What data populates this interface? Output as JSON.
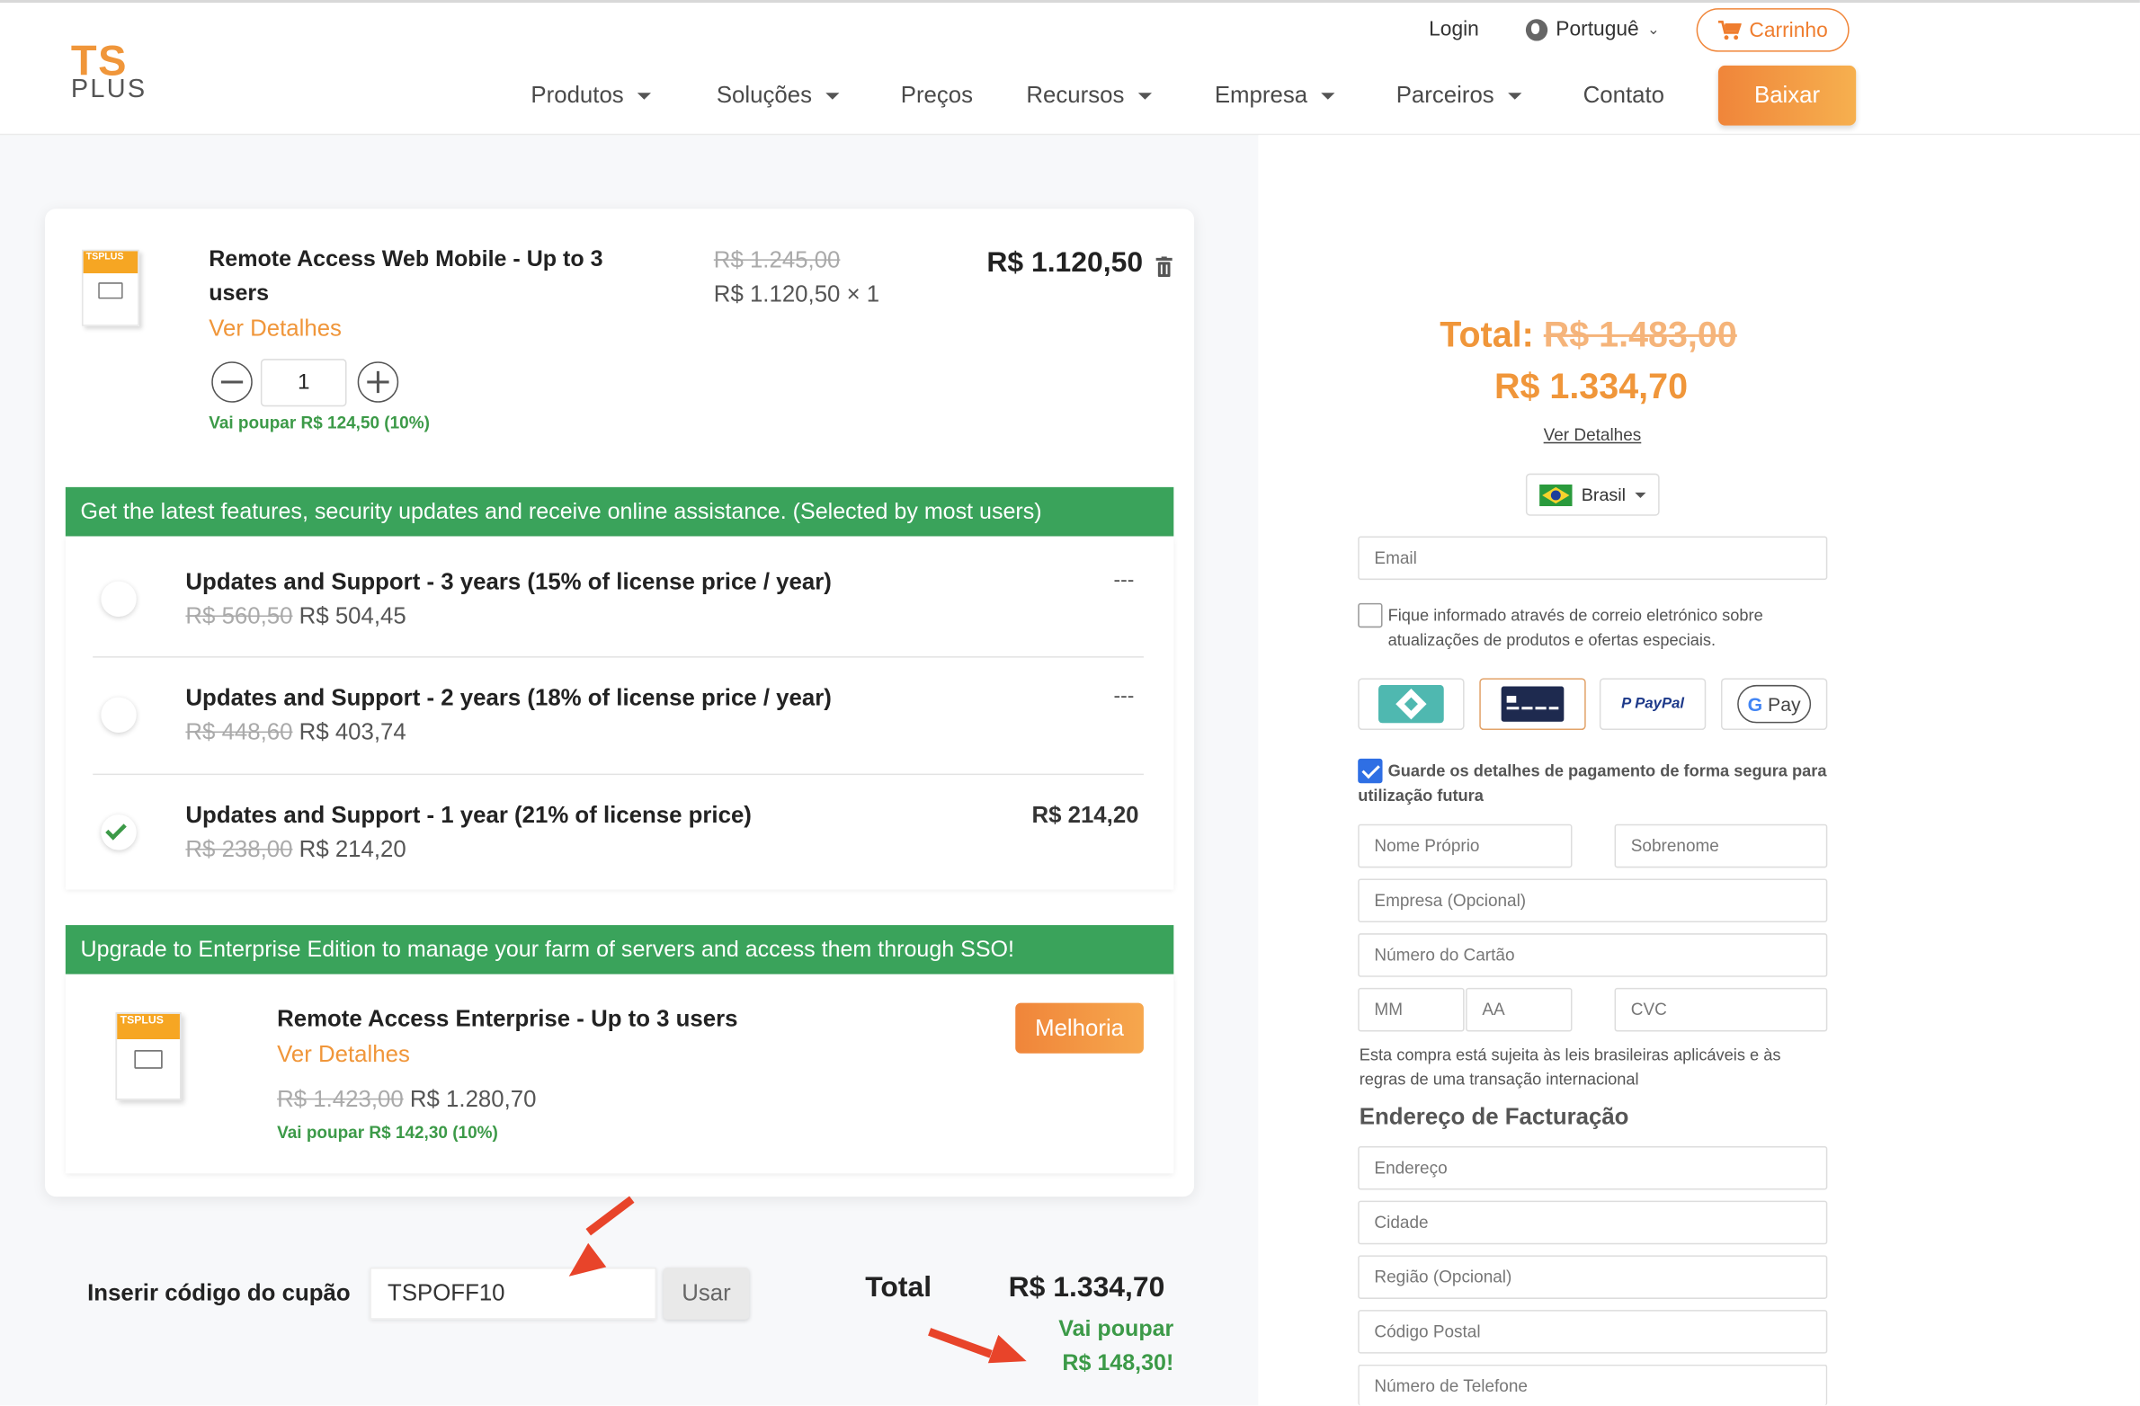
{
  "header": {
    "logo_top": "TS",
    "logo_bottom": "PLUS",
    "login": "Login",
    "language": "Portuguê",
    "cart": "Carrinho",
    "nav": [
      "Produtos",
      "Soluções",
      "Preços",
      "Recursos",
      "Empresa",
      "Parceiros",
      "Contato"
    ],
    "download": "Baixar"
  },
  "cart_item": {
    "title": "Remote Access Web Mobile - Up to 3 users",
    "title_line1": "Remote Access Web Mobile - Up to 3",
    "title_line2": "users",
    "details_link": "Ver Detalhes",
    "old_price": "R$ 1.245,00",
    "unit_price": "R$ 1.120,50 × 1",
    "line_total": "R$ 1.120,50",
    "quantity": "1",
    "savings": "Vai poupar R$ 124,50 (10%)",
    "box_label": "TSPLUS"
  },
  "support": {
    "banner": "Get the latest features, security updates and receive online assistance. (Selected by most users)",
    "options": [
      {
        "title": "Updates and Support - 3 years (15% of license price / year)",
        "old": "R$ 560,50",
        "price": "R$ 504,45",
        "right": "---",
        "selected": false
      },
      {
        "title": "Updates and Support - 2 years (18% of license price / year)",
        "old": "R$ 448,60",
        "price": "R$ 403,74",
        "right": "---",
        "selected": false
      },
      {
        "title": "Updates and Support - 1 year (21% of license price)",
        "old": "R$ 238,00",
        "price": "R$ 214,20",
        "right": "R$ 214,20",
        "selected": true
      }
    ]
  },
  "upgrade": {
    "banner": "Upgrade to Enterprise Edition to manage your farm of servers and access them through SSO!",
    "title": "Remote Access Enterprise - Up to 3 users",
    "details_link": "Ver Detalhes",
    "old_price": "R$ 1.423,00",
    "price": "R$ 1.280,70",
    "savings": "Vai poupar R$ 142,30 (10%)",
    "button": "Melhoria",
    "box_label": "TSPLUS"
  },
  "coupon": {
    "label": "Inserir código do cupão",
    "value": "TSPOFF10",
    "button": "Usar"
  },
  "total": {
    "label": "Total",
    "value": "R$ 1.334,70",
    "savings_line1": "Vai poupar",
    "savings_line2": "R$ 148,30!"
  },
  "summary": {
    "total_label": "Total:",
    "old_total": "R$ 1.483,00",
    "new_total": "R$ 1.334,70",
    "details_link": "Ver Detalhes",
    "country": "Brasil"
  },
  "form": {
    "email_placeholder": "Email",
    "newsletter_text": "Fique informado através de correio eletrónico sobre atualizações de produtos e ofertas especiais.",
    "newsletter_checked": false,
    "payment_methods": [
      "Pix",
      "Card",
      "PayPal",
      "G Pay"
    ],
    "paypal_label": "PayPal",
    "gpay_g": "G",
    "gpay_label": "Pay",
    "save_details_text": "Guarde os detalhes de pagamento de forma segura para utilização futura",
    "save_details_checked": true,
    "first_name": "Nome Próprio",
    "last_name": "Sobrenome",
    "company": "Empresa (Opcional)",
    "card_number": "Número do Cartão",
    "mm": "MM",
    "aa": "AA",
    "cvc": "CVC",
    "legal_text": "Esta compra está sujeita às leis brasileiras aplicáveis e às regras de uma transação internacional",
    "billing_heading": "Endereço de Facturação",
    "address": "Endereço",
    "city": "Cidade",
    "region": "Região (Opcional)",
    "postal_code": "Código Postal",
    "phone": "Número de Telefone"
  },
  "colors": {
    "accent_orange": "#f0963a",
    "banner_green": "#3aa35b",
    "savings_green": "#3c9a48",
    "annotation_red": "#e8442a"
  }
}
